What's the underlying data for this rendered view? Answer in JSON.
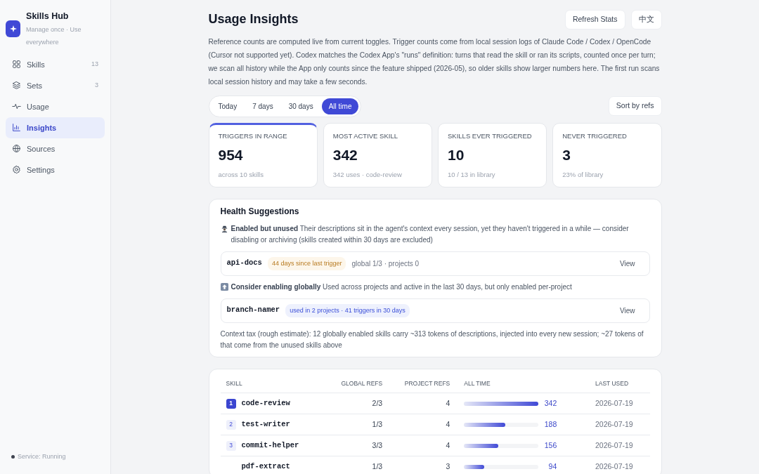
{
  "app": {
    "name": "Skills Hub",
    "tagline": "Manage once · Use everywhere"
  },
  "sidebar": {
    "items": [
      {
        "kind": "grid",
        "label": "Skills",
        "count": "13",
        "selected": false
      },
      {
        "kind": "layers",
        "label": "Sets",
        "count": "3",
        "selected": false
      },
      {
        "kind": "pulse",
        "label": "Usage",
        "selected": false
      },
      {
        "kind": "chart",
        "label": "Insights",
        "selected": true
      },
      {
        "kind": "globe",
        "label": "Sources",
        "selected": false
      },
      {
        "kind": "gear",
        "label": "Settings",
        "selected": false
      }
    ],
    "status": {
      "text": "Service: Running",
      "color": "#3f4450"
    }
  },
  "header": {
    "title": "Usage Insights",
    "buttons": [
      "Refresh Stats",
      "中文"
    ]
  },
  "description": "Reference counts are computed live from current toggles. Trigger counts come from local session logs of Claude Code / Codex / OpenCode (Cursor not supported yet). Codex matches the Codex App's \"runs\" definition: turns that read the skill or ran its scripts, counted once per turn; we scan all history while the App only counts since the feature shipped (2026-05), so older skills show larger numbers here. The first run scans local session history and may take a few seconds.",
  "range_tabs": [
    {
      "label": "Today",
      "selected": false
    },
    {
      "label": "7 days",
      "selected": false
    },
    {
      "label": "30 days",
      "selected": false
    },
    {
      "label": "All time",
      "selected": true
    }
  ],
  "sort_button": "Sort by refs",
  "stats": [
    {
      "label": "TRIGGERS IN RANGE",
      "value": "954",
      "note": "across 10 skills",
      "highlighted": true
    },
    {
      "label": "MOST ACTIVE SKILL",
      "value": "342",
      "note": "342 uses · code-review",
      "highlighted": false
    },
    {
      "label": "SKILLS EVER TRIGGERED",
      "value": "10",
      "note": "10 / 13 in library",
      "highlighted": false
    },
    {
      "label": "NEVER TRIGGERED",
      "value": "3",
      "note": "23% of library",
      "highlighted": false
    }
  ],
  "health": {
    "title": "Health Suggestions",
    "groups": [
      {
        "kind": "spy",
        "title": "Enabled but unused",
        "text": "Their descriptions sit in the agent's context every session, yet they haven't triggered in a while — consider disabling or archiving (skills created within 30 days are excluded)",
        "items": [
          {
            "name": "api-docs",
            "tag": "44 days since last trigger",
            "kind": "warning",
            "meta": "global 1/3 · projects 0",
            "action": "View"
          }
        ]
      },
      {
        "kind": "up",
        "title": "Consider enabling globally",
        "text": "Used across projects and active in the last 30 days, but only enabled per-project",
        "items": [
          {
            "name": "branch-namer",
            "tag": "used in 2 projects · 41 triggers in 30 days",
            "kind": "info",
            "action": "View"
          }
        ]
      }
    ],
    "footnote": "Context tax (rough estimate): 12 globally enabled skills carry ~313 tokens of descriptions, injected into every new session; ~27 tokens of that come from the unused skills above"
  },
  "table": {
    "columns": [
      "SKILL",
      "GLOBAL REFS",
      "PROJECT REFS",
      "ALL TIME",
      "LAST USED"
    ],
    "rows": [
      {
        "rank": "1",
        "top": true,
        "name": "code-review",
        "global": "2/3",
        "project": "4",
        "level": 1.0,
        "count": "342",
        "last": "2026-07-19"
      },
      {
        "rank": "2",
        "top": false,
        "name": "test-writer",
        "global": "1/3",
        "project": "4",
        "level": 0.55,
        "count": "188",
        "last": "2026-07-19"
      },
      {
        "rank": "3",
        "top": false,
        "name": "commit-helper",
        "global": "3/3",
        "project": "4",
        "level": 0.46,
        "count": "156",
        "last": "2026-07-19"
      },
      {
        "name": "pdf-extract",
        "global": "1/3",
        "project": "3",
        "level": 0.27,
        "count": "94",
        "last": "2026-07-19"
      }
    ]
  }
}
